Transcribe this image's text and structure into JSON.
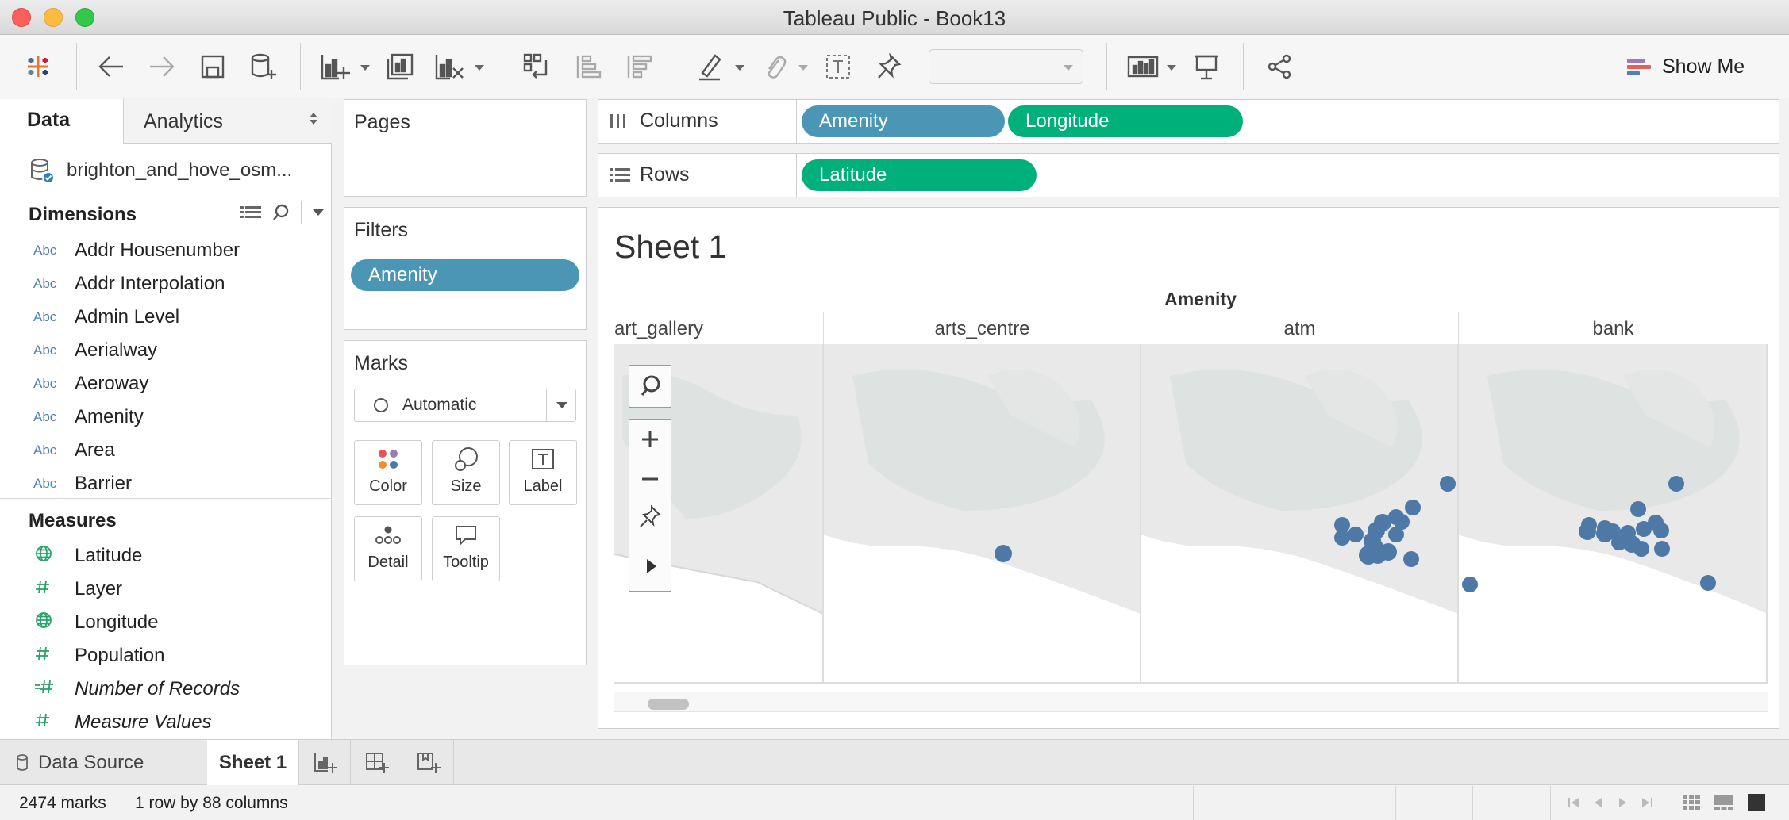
{
  "window": {
    "title": "Tableau Public - Book13"
  },
  "toolbar": {
    "show_me_label": "Show Me",
    "show_me_colors": [
      "#9b7bb8",
      "#e0625a",
      "#4f81b4"
    ]
  },
  "left_pane": {
    "tabs": [
      "Data",
      "Analytics"
    ],
    "datasource": "brighton_and_hove_osm...",
    "dimensions_title": "Dimensions",
    "dimension_type": "Abc",
    "dimensions": [
      "Addr Housenumber",
      "Addr Interpolation",
      "Admin Level",
      "Aerialway",
      "Aeroway",
      "Amenity",
      "Area",
      "Barrier"
    ],
    "measures_title": "Measures",
    "measures": [
      {
        "name": "Latitude",
        "icon": "globe-icon",
        "italic": false
      },
      {
        "name": "Layer",
        "icon": "hash-icon",
        "italic": false
      },
      {
        "name": "Longitude",
        "icon": "globe-icon",
        "italic": false
      },
      {
        "name": "Population",
        "icon": "hash-icon",
        "italic": false
      },
      {
        "name": "Number of Records",
        "icon": "calc-hash-icon",
        "italic": true
      },
      {
        "name": "Measure Values",
        "icon": "hash-icon",
        "italic": true
      }
    ]
  },
  "pages": {
    "title": "Pages"
  },
  "filters": {
    "title": "Filters",
    "pills": [
      "Amenity"
    ]
  },
  "marks": {
    "title": "Marks",
    "type": "Automatic",
    "buttons": [
      "Color",
      "Size",
      "Label",
      "Detail",
      "Tooltip"
    ]
  },
  "shelves": {
    "columns_label": "Columns",
    "columns": [
      {
        "name": "Amenity",
        "kind": "dimension"
      },
      {
        "name": "Longitude",
        "kind": "measure"
      }
    ],
    "rows_label": "Rows",
    "rows": [
      {
        "name": "Latitude",
        "kind": "measure"
      }
    ]
  },
  "view": {
    "sheet_title": "Sheet 1",
    "header_field": "Amenity",
    "panes": [
      "art_gallery",
      "arts_centre",
      "atm",
      "bank"
    ],
    "mark_color": "#4e79a7"
  },
  "sheet_tabs": {
    "data_source": "Data Source",
    "active_sheet": "Sheet 1"
  },
  "status": {
    "marks": "2474 marks",
    "dims": "1 row by 88 columns"
  }
}
